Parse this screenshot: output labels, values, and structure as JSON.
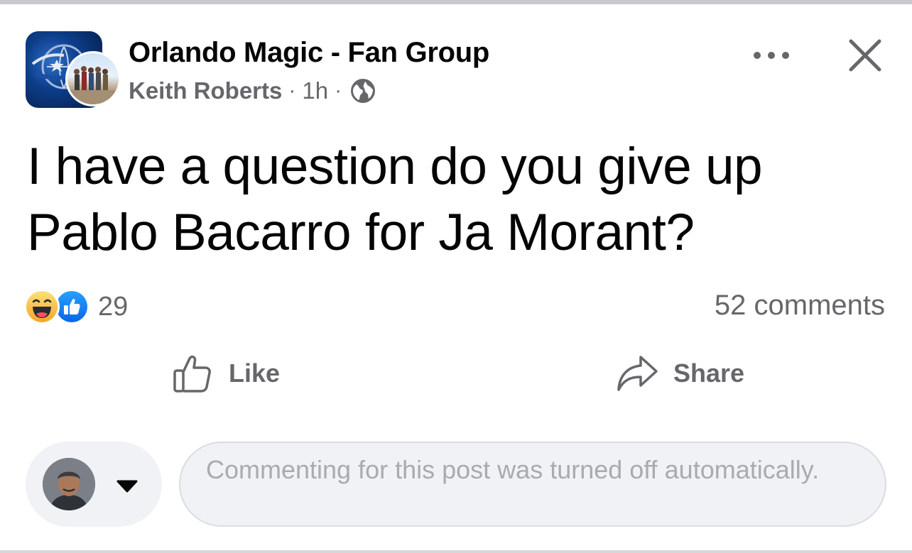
{
  "post": {
    "group_name": "Orlando Magic - Fan Group",
    "author": "Keith Roberts",
    "time": "1h",
    "separator": "·",
    "audience_icon": "globe-icon",
    "text": "I have a question do you give up Pablo Bacarro for Ja Morant?"
  },
  "header": {
    "more_icon": "more-dots-icon",
    "close_icon": "close-icon"
  },
  "reactions": {
    "icons": [
      "haha-reaction-icon",
      "like-reaction-icon"
    ],
    "count": "29"
  },
  "comments": {
    "count_label": "52 comments"
  },
  "actions": {
    "like_label": "Like",
    "share_label": "Share"
  },
  "composer": {
    "placeholder": "Commenting for this post was turned off automatically."
  },
  "colors": {
    "primary_text": "#050505",
    "secondary_text": "#65676b",
    "like_blue": "#1877f2",
    "haha_yellow": "#f7b928",
    "input_bg": "#f0f2f5"
  }
}
